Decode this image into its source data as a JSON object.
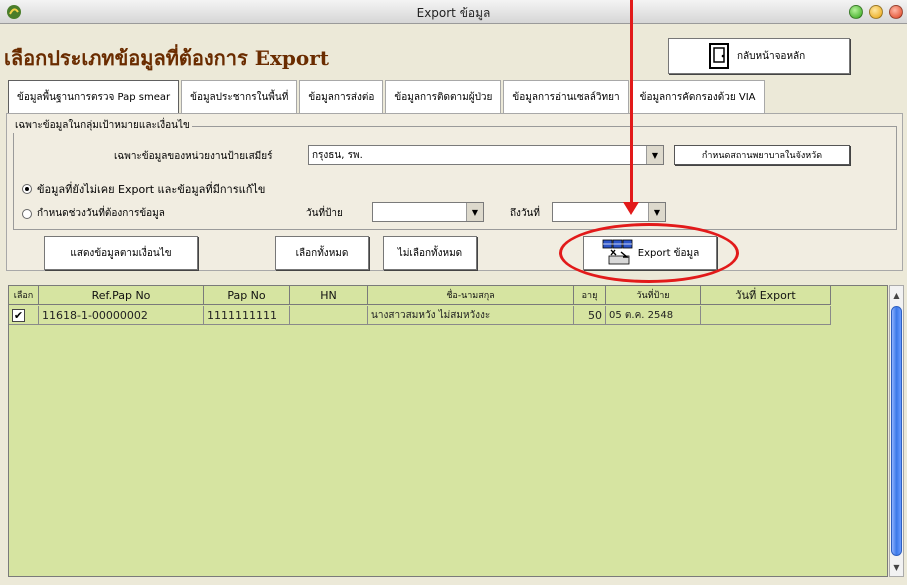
{
  "window": {
    "title": "Export ข้อมูล"
  },
  "header": {
    "page_title": "เลือกประเภทข้อมูลที่ต้องการ Export",
    "home_button_label": "กลับหน้าจอหลัก"
  },
  "tabs": [
    {
      "label": "ข้อมูลพื้นฐานการตรวจ Pap smear",
      "active": true
    },
    {
      "label": "ข้อมูลประชากรในพื้นที่",
      "active": false
    },
    {
      "label": "ข้อมูลการส่งต่อ",
      "active": false
    },
    {
      "label": "ข้อมูลการติดตามผู้ป่วย",
      "active": false
    },
    {
      "label": "ข้อมูลการอ่านเซลล์วิทยา",
      "active": false
    },
    {
      "label": "ข้อมูลการคัดกรองด้วย VIA",
      "active": false
    }
  ],
  "filter": {
    "group_label": "เฉพาะข้อมูลในกลุ่มเป้าหมายและเงื่อนไข",
    "unit_label": "เฉพาะข้อมูลของหน่วยงานป้ายเสมียร์",
    "unit_value": "กรุงธน, รพ.",
    "hospital_button": "กำหนดสถานพยาบาลในจังหวัด",
    "radio_unexported": "ข้อมูลที่ยังไม่เคย Export และข้อมูลที่มีการแก้ไข",
    "radio_date_range": "กำหนดช่วงวันที่ต้องการข้อมูล",
    "date_from_label": "วันที่ป้าย",
    "date_to_label": "ถึงวันที่",
    "selected_radio": "unexported"
  },
  "actions": {
    "show_label": "แสดงข้อมูลตามเงื่อนไข",
    "select_all_label": "เลือกทั้งหมด",
    "deselect_all_label": "ไม่เลือกทั้งหมด",
    "export_label": "Export ข้อมูล"
  },
  "table": {
    "columns": [
      "เลือก",
      "Ref.Pap No",
      "Pap No",
      "HN",
      "ชื่อ-นามสกุล",
      "อายุ",
      "วันที่ป้าย",
      "วันที่ Export"
    ],
    "rows": [
      {
        "checked": true,
        "ref_pap_no": "11618-1-00000002",
        "pap_no": "1111111111",
        "hn": "",
        "name": "นางสาวสมหวัง ไม่สมหวังงะ",
        "age": "50",
        "smear_date": "05 ต.ค. 2548",
        "export_date": ""
      }
    ]
  },
  "colors": {
    "table_bg": "#d6e4a1",
    "title_color": "#6a2c00",
    "annotation": "#e21a1a"
  }
}
